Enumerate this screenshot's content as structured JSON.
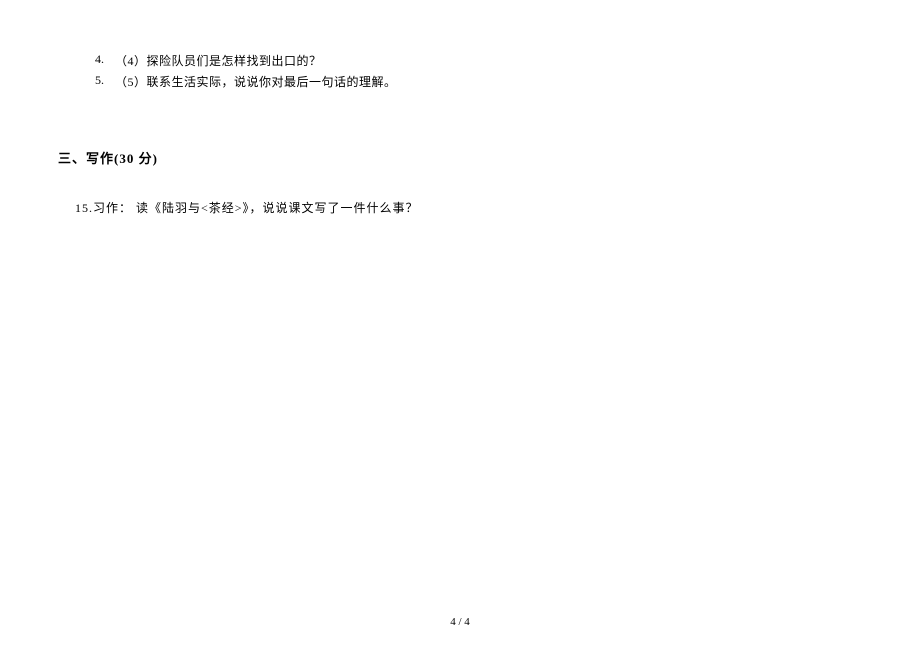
{
  "questions": [
    {
      "num": "4.",
      "text": "（4）探险队员们是怎样找到出口的？"
    },
    {
      "num": "5.",
      "text": "（5）联系生活实际，说说你对最后一句话的理解。"
    }
  ],
  "section": {
    "heading": "三、写作(30 分)"
  },
  "exercise": {
    "text": "15.习作：  读《陆羽与<茶经>》，说说课文写了一件什么事？"
  },
  "footer": {
    "page": "4 / 4"
  }
}
